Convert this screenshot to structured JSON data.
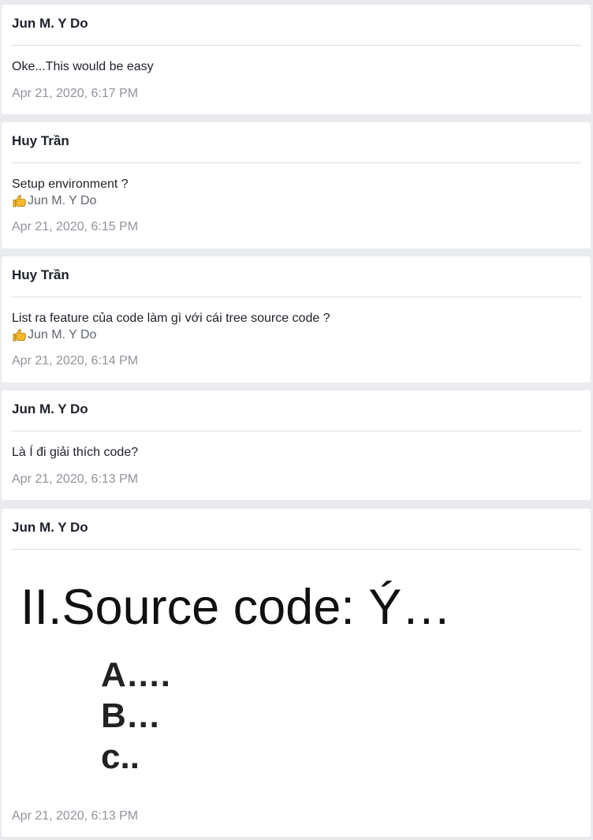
{
  "messages": [
    {
      "author": "Jun M. Y Do",
      "text": "Oke...This would be easy",
      "timestamp": "Apr 21, 2020, 6:17 PM"
    },
    {
      "author": "Huy Trần",
      "text": "Setup environment ?",
      "reaction": {
        "icon": "thumbs-up-icon",
        "user": "Jun M. Y Do"
      },
      "timestamp": "Apr 21, 2020, 6:15 PM"
    },
    {
      "author": "Huy Trần",
      "text": "List ra feature của code làm gì với cái tree source code ?",
      "reaction": {
        "icon": "thumbs-up-icon",
        "user": "Jun M. Y Do"
      },
      "timestamp": "Apr 21, 2020, 6:14 PM"
    },
    {
      "author": "Jun M. Y Do",
      "text": "Là Í đi giải thích code?",
      "timestamp": "Apr 21, 2020, 6:13 PM"
    },
    {
      "author": "Jun M. Y Do",
      "image": {
        "title": "II.Source code: Ý…",
        "items": [
          "A….",
          "B…",
          "c.."
        ]
      },
      "timestamp": "Apr 21, 2020, 6:13 PM"
    }
  ],
  "colors": {
    "page_background": "#e9ebee",
    "card_background": "#ffffff",
    "author_text": "#1d2129",
    "timestamp_text": "#90949c",
    "reaction_text": "#606770",
    "thumb": "#f7b928"
  }
}
